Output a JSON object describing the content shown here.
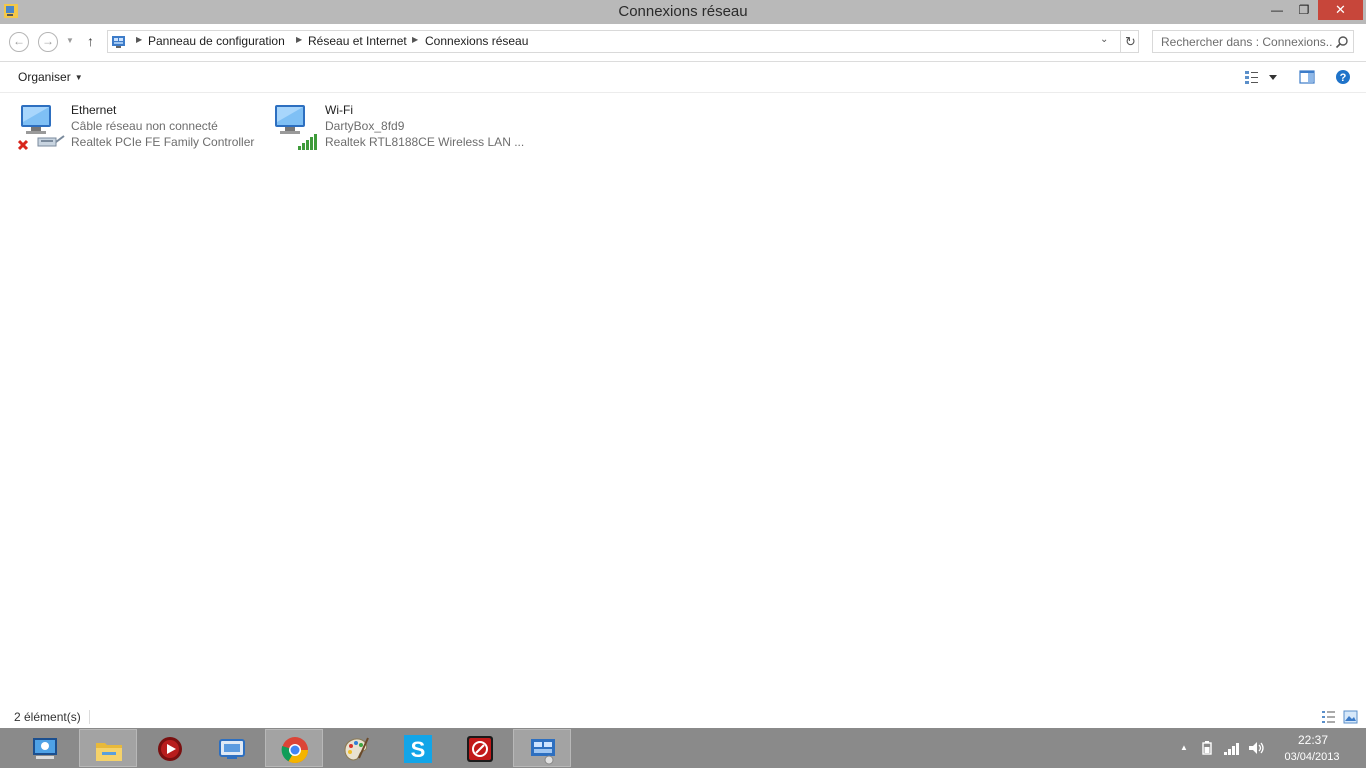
{
  "window": {
    "title": "Connexions réseau",
    "controls": {
      "minimize": "—",
      "restore": "❐",
      "close": "✕"
    }
  },
  "nav": {
    "back": "←",
    "forward": "→",
    "up": "↑",
    "breadcrumb": [
      "Panneau de configuration",
      "Réseau et Internet",
      "Connexions réseau"
    ],
    "search_placeholder": "Rechercher dans : Connexions..."
  },
  "toolbar": {
    "organise_label": "Organiser"
  },
  "connections": [
    {
      "name": "Ethernet",
      "status": "Câble réseau non connecté",
      "device": "Realtek PCIe FE Family Controller",
      "icon": "ethernet-disconnected-icon"
    },
    {
      "name": "Wi-Fi",
      "status": "DartyBox_8fd9",
      "device": "Realtek RTL8188CE Wireless LAN ...",
      "icon": "wifi-connected-icon"
    }
  ],
  "statusbar": {
    "item_count": "2 élément(s)"
  },
  "taskbar": {
    "apps": [
      "network-app-icon",
      "file-explorer-icon",
      "media-player-icon",
      "remote-desktop-icon",
      "chrome-icon",
      "paint-icon",
      "skype-icon",
      "red-app-icon",
      "control-panel-icon"
    ],
    "time": "22:37",
    "date": "03/04/2013"
  },
  "colors": {
    "titlebar": "#b9b9b9",
    "close_button": "#c7463a",
    "taskbar": "#8a8a8a",
    "accent_blue": "#1f73c9"
  }
}
